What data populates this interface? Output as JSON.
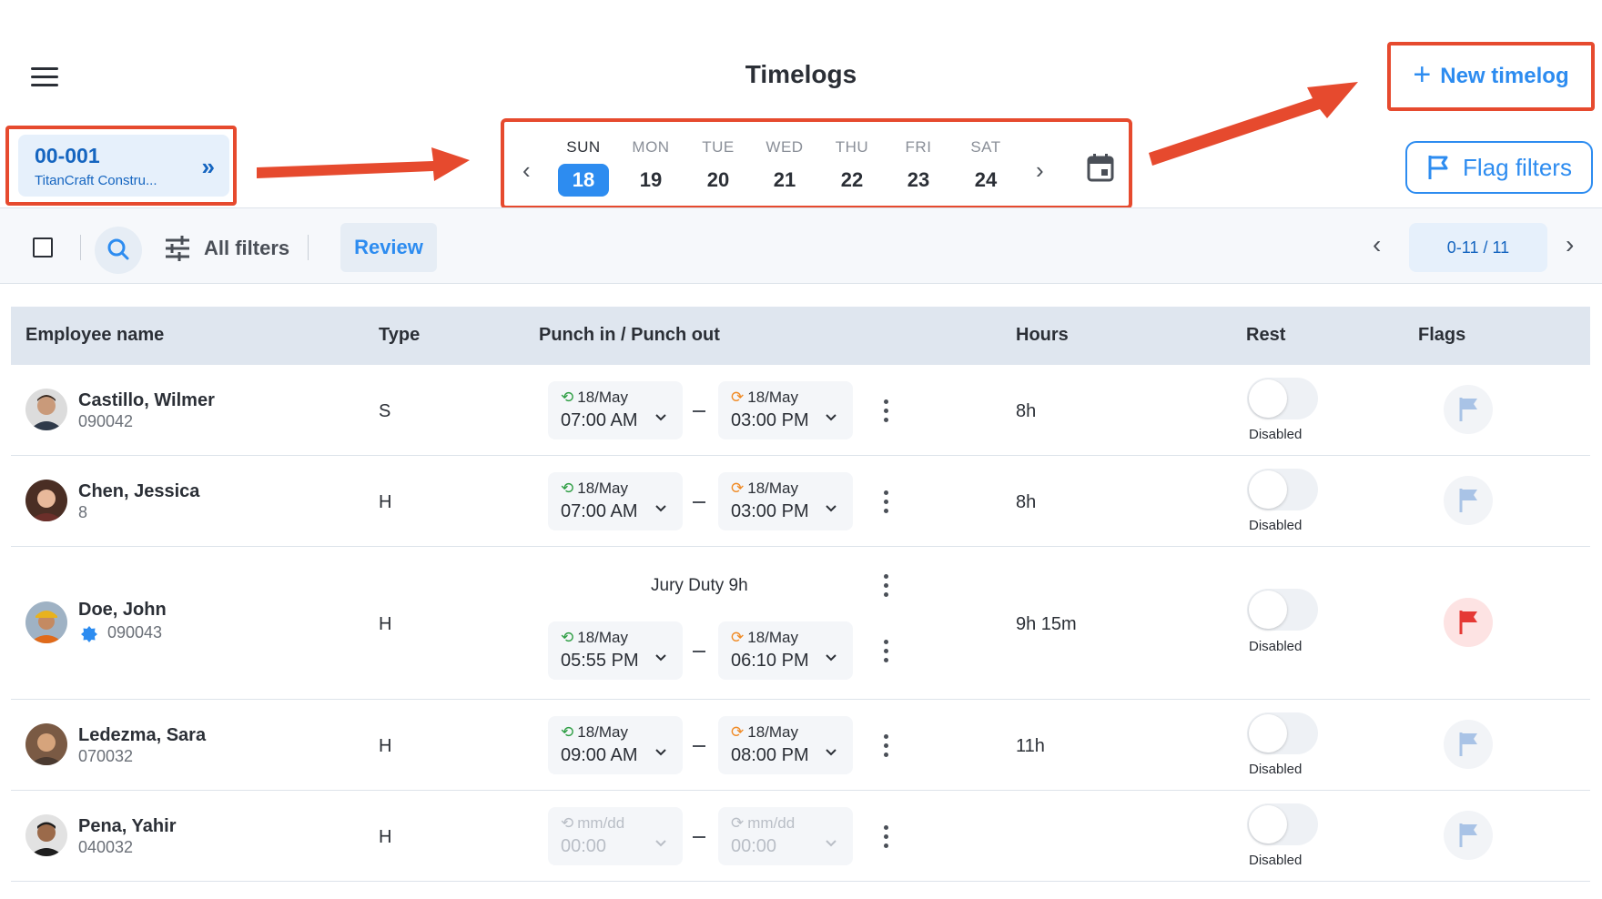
{
  "header": {
    "title": "Timelogs",
    "new_button_label": "New timelog",
    "flag_filters_label": "Flag filters"
  },
  "project": {
    "code": "00-001",
    "name": "TitanCraft Constru..."
  },
  "week": {
    "days": [
      {
        "name": "SUN",
        "num": "18",
        "active": true
      },
      {
        "name": "MON",
        "num": "19"
      },
      {
        "name": "TUE",
        "num": "20"
      },
      {
        "name": "WED",
        "num": "21"
      },
      {
        "name": "THU",
        "num": "22"
      },
      {
        "name": "FRI",
        "num": "23"
      },
      {
        "name": "SAT",
        "num": "24"
      }
    ]
  },
  "toolbar": {
    "filters_label": "All filters",
    "review_label": "Review",
    "pagination": "0-11 / 11"
  },
  "table": {
    "headers": {
      "name": "Employee name",
      "type": "Type",
      "punch": "Punch in / Punch out",
      "hours": "Hours",
      "rest": "Rest",
      "flags": "Flags"
    },
    "rows": [
      {
        "name": "Castillo, Wilmer",
        "id": "090042",
        "type": "S",
        "in_date": "18/May",
        "in_time": "07:00 AM",
        "out_date": "18/May",
        "out_time": "03:00 PM",
        "hours": "8h",
        "rest": "Disabled",
        "flag": "neutral"
      },
      {
        "name": "Chen, Jessica",
        "id": "8",
        "type": "H",
        "in_date": "18/May",
        "in_time": "07:00 AM",
        "out_date": "18/May",
        "out_time": "03:00 PM",
        "hours": "8h",
        "rest": "Disabled",
        "flag": "neutral"
      },
      {
        "name": "Doe, John",
        "id": "090043",
        "type": "H",
        "note": "Jury Duty 9h",
        "in_date": "18/May",
        "in_time": "05:55 PM",
        "out_date": "18/May",
        "out_time": "06:10 PM",
        "hours": "9h 15m",
        "rest": "Disabled",
        "flag": "red"
      },
      {
        "name": "Ledezma, Sara",
        "id": "070032",
        "type": "H",
        "in_date": "18/May",
        "in_time": "09:00 AM",
        "out_date": "18/May",
        "out_time": "08:00 PM",
        "hours": "11h",
        "rest": "Disabled",
        "flag": "neutral"
      },
      {
        "name": "Pena, Yahir",
        "id": "040032",
        "type": "H",
        "in_date": "mm/dd",
        "in_time": "00:00",
        "out_date": "mm/dd",
        "out_time": "00:00",
        "hours": "",
        "rest": "Disabled",
        "flag": "neutral"
      }
    ]
  },
  "colors": {
    "accent": "#2d8cf0",
    "annotation": "#e64a2e",
    "header_bg": "#dfe6ef",
    "flag_red": "#e53935",
    "flag_neutral": "#a9c3e6"
  }
}
